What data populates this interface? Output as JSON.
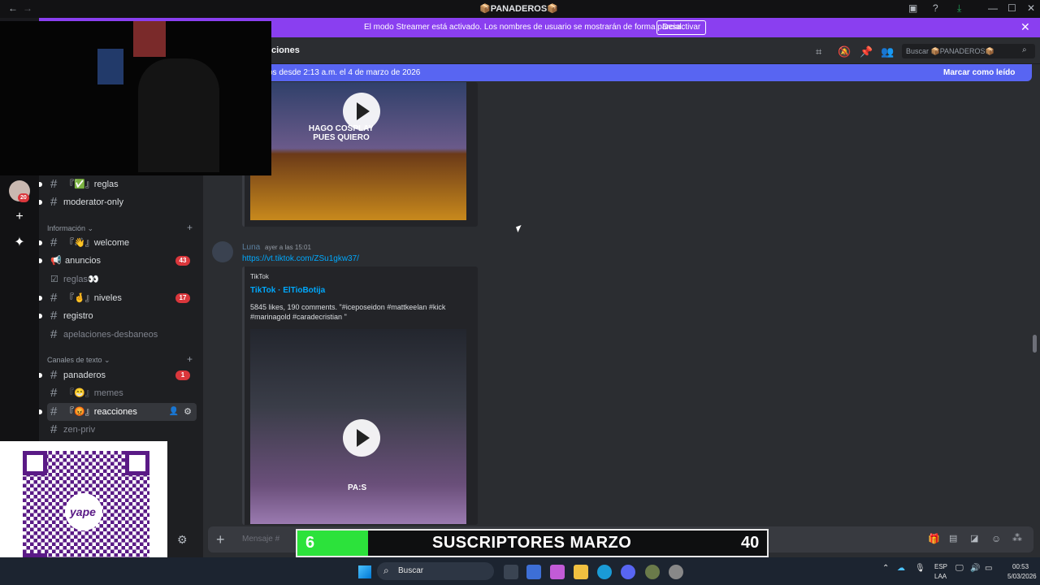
{
  "window": {
    "title": "📦PANADEROS📦",
    "back_icon": "←",
    "forward_icon": "→",
    "controls": [
      "—",
      "☐",
      "✕"
    ]
  },
  "streamer_banner": {
    "message": "El modo Streamer está activado. Los nombres de usuario se mostrarán de forma parcial.",
    "button": "Desactivar",
    "close": "✕"
  },
  "server_rail": {
    "avatar_badge": "20",
    "add_icon": "+",
    "explore_icon": "✦"
  },
  "channels": {
    "top": [
      {
        "icon": "#",
        "name": "『✅』reglas",
        "muted": false,
        "unread": true
      },
      {
        "icon": "#",
        "name": "moderator-only",
        "muted": false,
        "unread": true
      }
    ],
    "informacion": {
      "title": "Información ⌄",
      "items": [
        {
          "icon": "#",
          "name": "『👋』welcome",
          "badge": "",
          "muted": false,
          "unread": true
        },
        {
          "icon": "📢",
          "name": "anuncios",
          "badge": "43",
          "muted": false,
          "unread": true
        },
        {
          "icon": "☑",
          "name": "reglas👀",
          "badge": "",
          "muted": true,
          "unread": false
        },
        {
          "icon": "#",
          "name": "『🤞』niveles",
          "badge": "17",
          "muted": false,
          "unread": true
        },
        {
          "icon": "#",
          "name": "registro",
          "badge": "",
          "muted": false,
          "unread": true
        },
        {
          "icon": "#",
          "name": "apelaciones-desbaneos",
          "badge": "",
          "muted": true,
          "unread": false
        }
      ]
    },
    "texto": {
      "title": "Canales de texto ⌄",
      "items": [
        {
          "icon": "#",
          "name": "panaderos",
          "badge": "1",
          "muted": false,
          "unread": true
        },
        {
          "icon": "#",
          "name": "『😁』memes",
          "badge": "",
          "muted": true,
          "unread": false
        },
        {
          "icon": "#",
          "name": "『😡』reacciones",
          "badge": "",
          "muted": false,
          "unread": true,
          "active": true
        },
        {
          "icon": "#",
          "name": "zen-priv",
          "badge": "",
          "muted": true,
          "unread": false
        }
      ]
    }
  },
  "header": {
    "channel_name": "ciones",
    "search_placeholder": "Buscar 📦PANADEROS📦"
  },
  "new_messages_bar": {
    "text": "vos desde 2:13 a.m. el 4 de marzo de 2026",
    "mark_read": "Marcar como leído"
  },
  "message": {
    "author": "Luna",
    "time": "ayer a las 15:01",
    "link": "https://vt.tiktok.com/ZSu1gkw37/",
    "embed": {
      "provider": "TikTok",
      "title": "TikTok · ElTioBotija",
      "description": "5845 likes, 190 comments. \"#iceposeidon #mattkeelan #kick #marinagold #caradecristian \"",
      "video_caption": "PA:S"
    },
    "previous_video_caption": "HAGO COSPLAY PUES QUIERO"
  },
  "composer": {
    "placeholder": "Mensaje #",
    "plus_icon": "+"
  },
  "subs_overlay": {
    "current": "6",
    "title": "SUSCRIPTORES MARZO",
    "goal": "40",
    "progress_fraction": 0.15
  },
  "taskbar": {
    "search": "Buscar",
    "language": "ESP",
    "language2": "LAA",
    "time": "00:53",
    "date": "5/03/2026"
  },
  "qr_brand": "yape",
  "colors": {
    "banner": "#8a3ff0",
    "new_bar": "#5865f2",
    "badge": "#da373c",
    "link": "#00a8fc",
    "progress": "#2ce23b"
  }
}
